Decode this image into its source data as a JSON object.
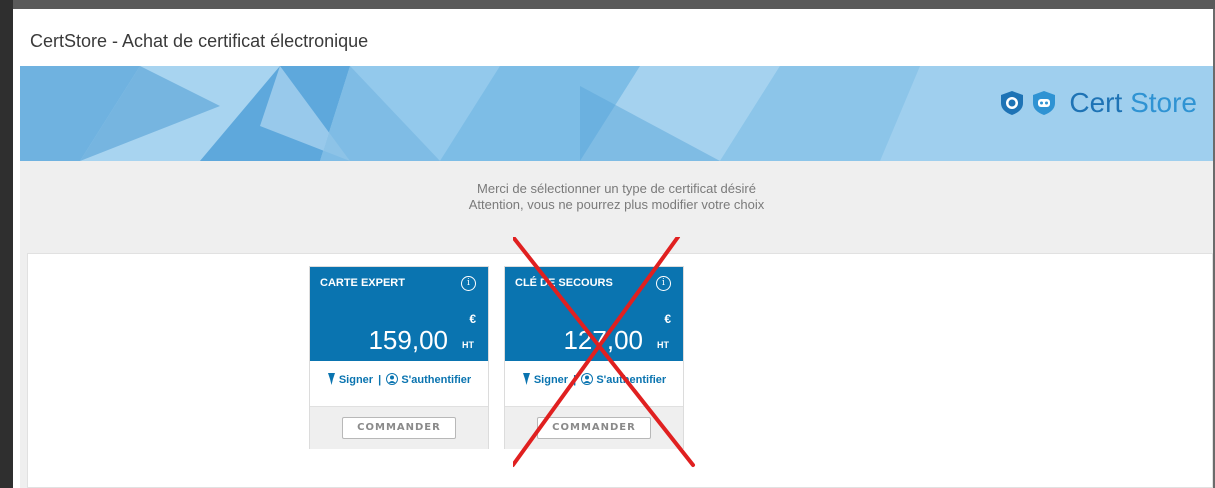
{
  "window": {
    "title": "CertStore - Achat de certificat électronique"
  },
  "brand": {
    "name_part1": "Cert",
    "name_part2": "Store",
    "icons": [
      "badge-icon",
      "shield-icon"
    ]
  },
  "notice": {
    "line1": "Merci de sélectionner un type de certificat désiré",
    "line2": "Attention, vous ne pourrez plus modifier votre choix"
  },
  "products": [
    {
      "name": "CARTE EXPERT",
      "currency": "€",
      "price": "159,00",
      "price_unit": "HT",
      "feature_sign": "Signer",
      "separator": "|",
      "feature_auth": "S'authentifier",
      "order_label": "COMMANDER",
      "crossed_out": false
    },
    {
      "name": "CLÉ DE SECOURS",
      "currency": "€",
      "price": "127,00",
      "price_unit": "HT",
      "feature_sign": "Signer",
      "separator": "|",
      "feature_auth": "S'authentifier",
      "order_label": "COMMANDER",
      "crossed_out": true
    }
  ],
  "colors": {
    "card_header": "#0a74b0",
    "banner": "#8cc5e9",
    "cross": "#e02020",
    "brand": "#1e73b5"
  }
}
